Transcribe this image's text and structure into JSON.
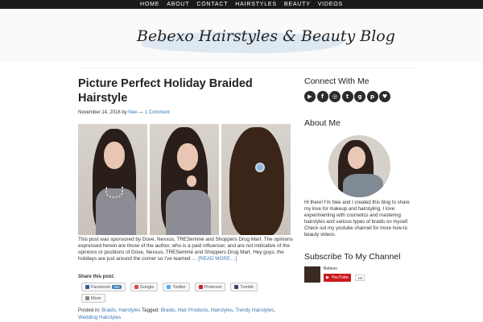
{
  "nav": {
    "items": [
      "HOME",
      "ABOUT",
      "CONTACT",
      "HAIRSTYLES",
      "BEAUTY",
      "VIDEOS"
    ]
  },
  "header": {
    "logo_text": "Bebexo Hairstyles & Beauty Blog"
  },
  "post": {
    "title": "Picture Perfect Holiday Braided Hairstyle",
    "date": "November 14, 2016",
    "by": "by",
    "author": "Nee",
    "sep": "—",
    "comments": "1 Comment",
    "excerpt": "This post was sponsored by Dove, Nexxus, TRESemmé and Shoppers Drug Mart. The opinions expressed herein are those of the author, who is a paid influencer, and are not indicative of the opinions or positions of Dove, Nexxus, TRESemmé and Shoppers Drug Mart. Hey guys, the holidays are just around the corner so I've teamed …",
    "read_more": "[READ MORE…]",
    "share_title": "Share this post:",
    "share_buttons": [
      {
        "label": "Facebook",
        "count": "353"
      },
      {
        "label": "Google"
      },
      {
        "label": "Twitter"
      },
      {
        "label": "Pinterest"
      },
      {
        "label": "Tumblr"
      }
    ],
    "more_label": "More",
    "posted_in_label": "Posted in:",
    "categories": [
      "Braids",
      "Hairstyles"
    ],
    "tagged_label": "Tagged:",
    "tags": [
      "Braids",
      "Hair Products",
      "Hairstyles",
      "Trendy Hairstyles",
      "Wedding Hairstyles"
    ]
  },
  "sidebar": {
    "connect_title": "Connect With Me",
    "social_icons": [
      "youtube-icon",
      "facebook-icon",
      "instagram-icon",
      "twitter-icon",
      "google-plus-icon",
      "pinterest-icon",
      "bloglovin-icon"
    ],
    "about_title": "About Me",
    "about_text": "Hi there! I'm Nee and I created this blog to share my love for makeup and hairstyling. I love experimenting with cosmetics and mastering hairstyles and various types of braids on myself. Check out my youtube channel for more how-to beauty videos.",
    "subscribe_title": "Subscribe To My Channel",
    "yt_channel": "Bebexo",
    "yt_button": "YouTube",
    "yt_count": "1M"
  },
  "colors": {
    "nav_bg": "#1a1a1a",
    "link": "#3a78b5",
    "youtube_red": "#cc181e",
    "logo_wash": "#d9e6f0"
  }
}
